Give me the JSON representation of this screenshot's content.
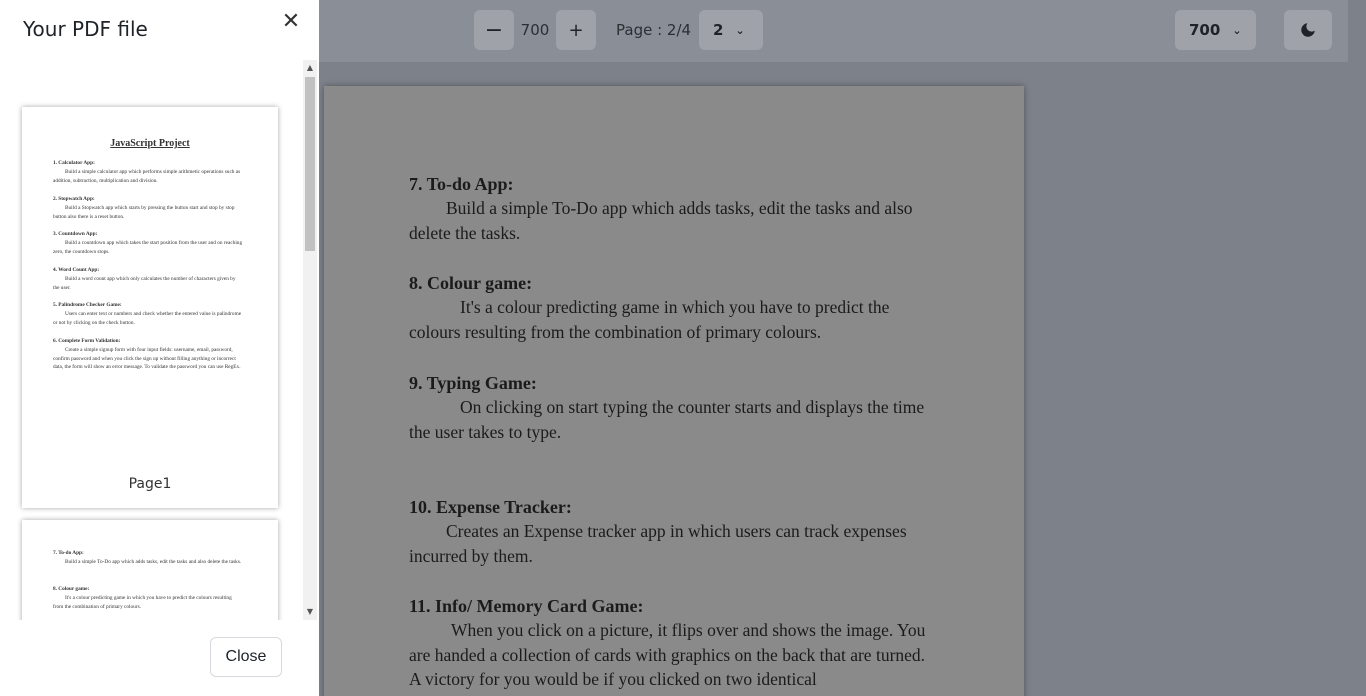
{
  "toolbar": {
    "zoom_out_icon": "−",
    "zoom_value": "700",
    "zoom_in_icon": "+",
    "page_label": "Page : 2/4",
    "page_select_value": "2",
    "zoom_select_value": "700",
    "chevron": "⌄",
    "theme_icon": "moon-icon"
  },
  "pdf_page": {
    "sections": [
      {
        "heading": "7. To-do App:",
        "text": "Build a simple To-Do app which adds tasks, edit the tasks and also delete the tasks."
      },
      {
        "heading": "8. Colour game:",
        "text": "It's a colour predicting game in which you have to predict the colours resulting from the combination of primary colours."
      },
      {
        "heading": "9. Typing Game:",
        "text": "On clicking on start typing the counter starts and displays the time the user takes to type."
      },
      {
        "heading": "10.  Expense Tracker:",
        "text": "Creates an Expense tracker app in which users can track expenses incurred by them."
      },
      {
        "heading": "11. Info/ Memory Card Game:",
        "text": "When you click on a picture, it flips over and shows the image. You are handed a collection of cards with graphics on the back that are turned. A victory for you would be if you clicked on two identical"
      }
    ]
  },
  "sidebar": {
    "title": "Your PDF file",
    "close_icon": "✕",
    "close_button": "Close",
    "thumbnails": [
      {
        "page_label": "Page1",
        "title": "JavaScript Project",
        "items": [
          {
            "heading": "1.  Calculator App:",
            "text": "Build a simple calculator app which performs simple arithmetic operations such as addition, subtraction, multiplication and division."
          },
          {
            "heading": "2. Stopwatch App:",
            "text": "Build a Stopwatch app which starts by pressing the button start and stop by stop button also there is a reset button."
          },
          {
            "heading": "3. Countdown App:",
            "text": "Build a countdown app which takes the start position from the user and on reaching zero, the countdown stops."
          },
          {
            "heading": "4. Word Count App:",
            "text": "Build a word count app which only calculates the number of characters given by the user."
          },
          {
            "heading": "5. Palindrome Checker Game:",
            "text": "Users can enter text or numbers and check whether the entered value is palindrome or not by clicking on the check button."
          },
          {
            "heading": "6. Complete Form Validation:",
            "text": "Create a simple signup form with four input fields: username, email, password, confirm password and when you click the sign up without filling anything or incorrect data, the form will show an error message. To validate the password you can use RegEx."
          }
        ]
      },
      {
        "page_label": "",
        "items": [
          {
            "heading": "7. To-do App:",
            "text": "Build a simple To-Do app which adds tasks, edit the tasks and also delete the tasks."
          },
          {
            "heading": "8. Colour game:",
            "text": "It's a colour predicting game in which you have to predict the colours resulting from the combination of primary colours."
          }
        ]
      }
    ]
  }
}
